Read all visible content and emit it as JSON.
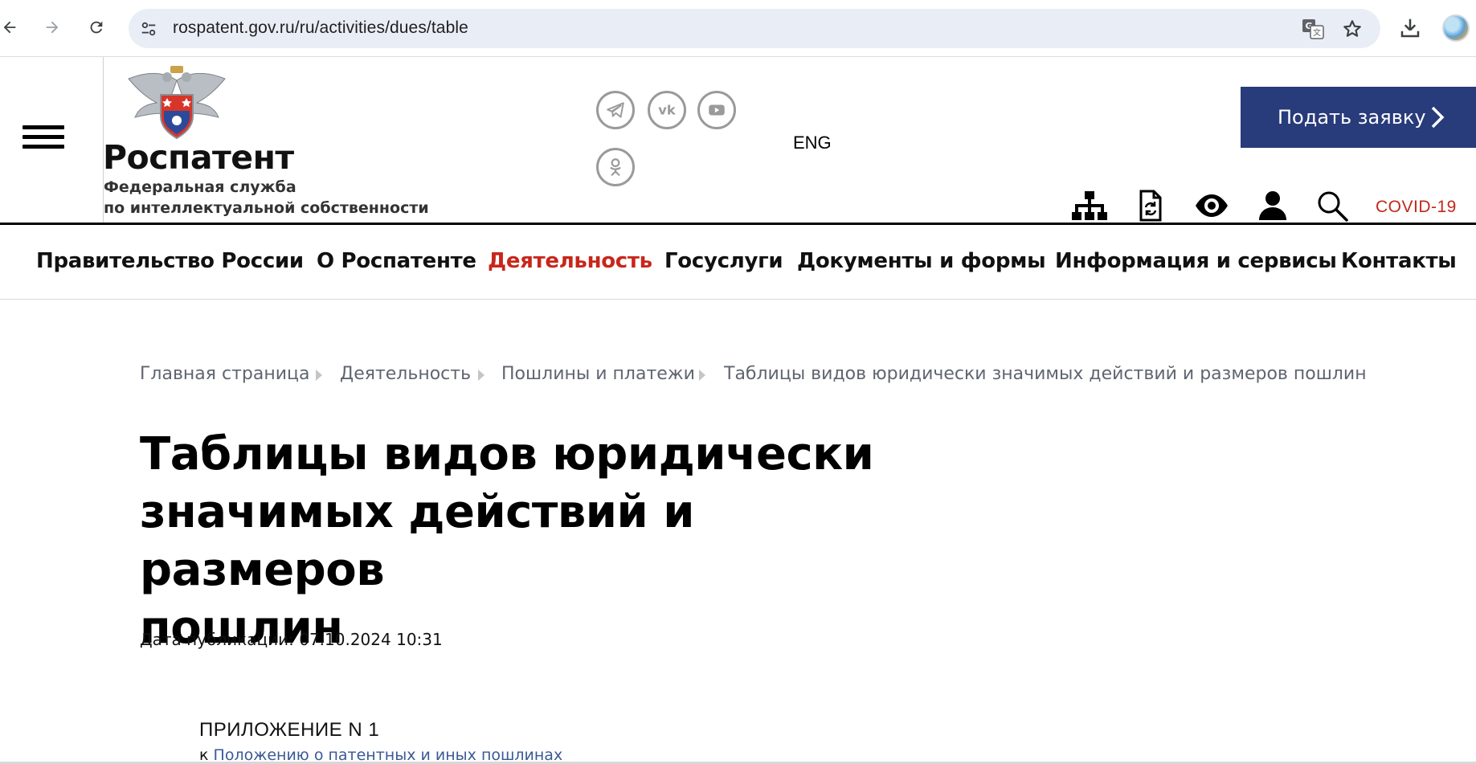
{
  "browser": {
    "url": "rospatent.gov.ru/ru/activities/dues/table",
    "icons": {
      "back": "arrow-left-icon",
      "forward": "arrow-right-icon",
      "reload": "reload-icon",
      "site_info": "tune-icon",
      "translate": "translate-icon",
      "bookmark": "star-icon",
      "download": "download-icon",
      "profile": "avatar"
    }
  },
  "header": {
    "brand_title": "Роспатент",
    "brand_sub_line1": "Федеральная служба",
    "brand_sub_line2": "по интеллектуальной собственности",
    "social": [
      "telegram-icon",
      "vk-icon",
      "youtube-icon",
      "odnoklassniki-icon"
    ],
    "lang": "ENG",
    "apply_button": "Подать заявку",
    "tools": [
      "sitemap-icon",
      "document-refresh-icon",
      "eye-icon",
      "user-icon",
      "search-icon"
    ],
    "covid": "COVID-19",
    "colors": {
      "apply_bg": "#283b7a",
      "accent_red": "#c8261a",
      "covid_red": "#c0291a"
    }
  },
  "mainnav": {
    "items": [
      {
        "label": "Правительство России"
      },
      {
        "label": "О Роспатенте"
      },
      {
        "label": "Деятельность",
        "active": true
      },
      {
        "label": "Госуслуги"
      },
      {
        "label": "Документы и формы"
      },
      {
        "label": "Информация и сервисы"
      },
      {
        "label": "Контакты"
      }
    ]
  },
  "breadcrumb": [
    "Главная страница",
    "Деятельность",
    "Пошлины и платежи",
    "Таблицы видов юридически значимых действий и размеров пошлин"
  ],
  "page": {
    "title_line1": "Таблицы видов юридически",
    "title_line2": "значимых действий и размеров",
    "title_line3": "пошлин",
    "pub_label": "Дата публикации:",
    "pub_value": "07.10.2024 10:31",
    "appendix_title": "ПРИЛОЖЕНИЕ N 1",
    "appendix_prefix": "к",
    "appendix_link": "Положению о патентных и иных пошлинах"
  }
}
